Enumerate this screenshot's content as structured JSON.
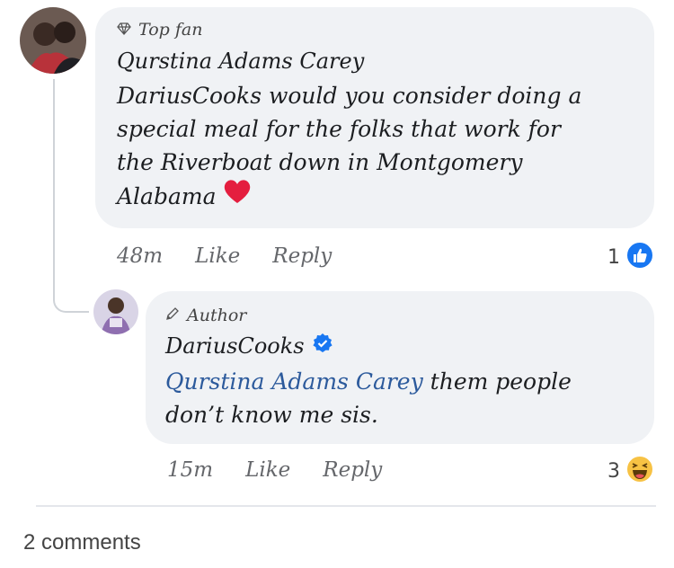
{
  "comment1": {
    "badge": "Top fan",
    "author": "Qurstina Adams Carey",
    "lines": [
      "DariusCooks would you consider doing a",
      "special meal for the folks that work  for",
      "the Riverboat down in Montgomery",
      "Alabama"
    ],
    "time": "48m",
    "like_label": "Like",
    "reply_label": "Reply",
    "reaction_count": "1",
    "reaction_icon": "like-icon"
  },
  "comment2": {
    "badge": "Author",
    "author": "DariusCooks",
    "mention": "Qurstina Adams Carey",
    "text_after_mention": " them people",
    "line2": "don’t know me sis.",
    "time": "15m",
    "like_label": "Like",
    "reply_label": "Reply",
    "reaction_count": "3",
    "reaction_icon": "haha-icon"
  },
  "footer": {
    "comments_count_label": "2 comments"
  },
  "colors": {
    "bubble": "#f0f2f5",
    "like_blue": "#1877f2",
    "heart_red": "#e41e3f",
    "haha_yellow": "#f7c244",
    "mention_blue": "#2c5a9c"
  }
}
